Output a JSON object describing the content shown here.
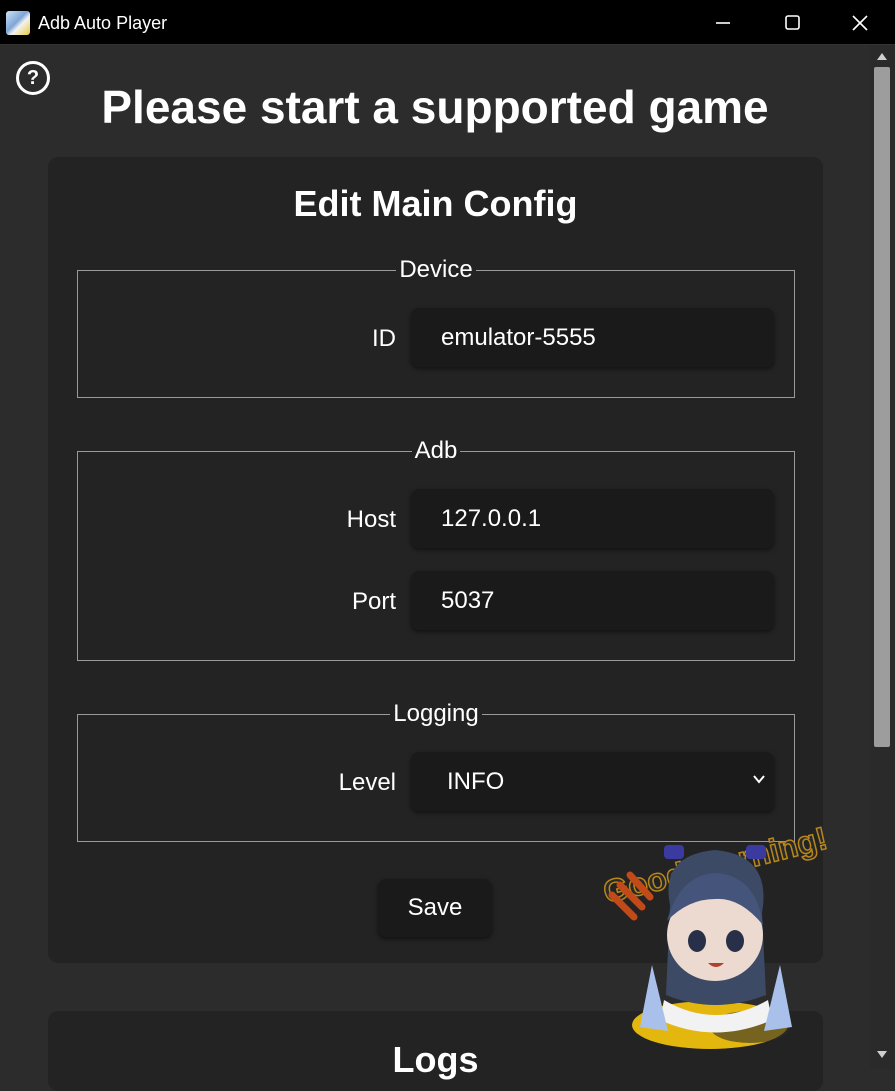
{
  "window": {
    "title": "Adb Auto Player"
  },
  "page": {
    "heading": "Please start a supported game"
  },
  "config": {
    "title": "Edit Main Config",
    "device": {
      "legend": "Device",
      "id_label": "ID",
      "id_value": "emulator-5555"
    },
    "adb": {
      "legend": "Adb",
      "host_label": "Host",
      "host_value": "127.0.0.1",
      "port_label": "Port",
      "port_value": "5037"
    },
    "logging": {
      "legend": "Logging",
      "level_label": "Level",
      "level_value": "INFO"
    },
    "save_label": "Save"
  },
  "logs": {
    "title": "Logs"
  },
  "mascot": {
    "caption": "Good Morning!",
    "accent": "#d4a017"
  },
  "colors": {
    "background": "#2c2c2c",
    "card": "#232323",
    "field": "#1a1a1a",
    "titlebar": "#000000"
  }
}
